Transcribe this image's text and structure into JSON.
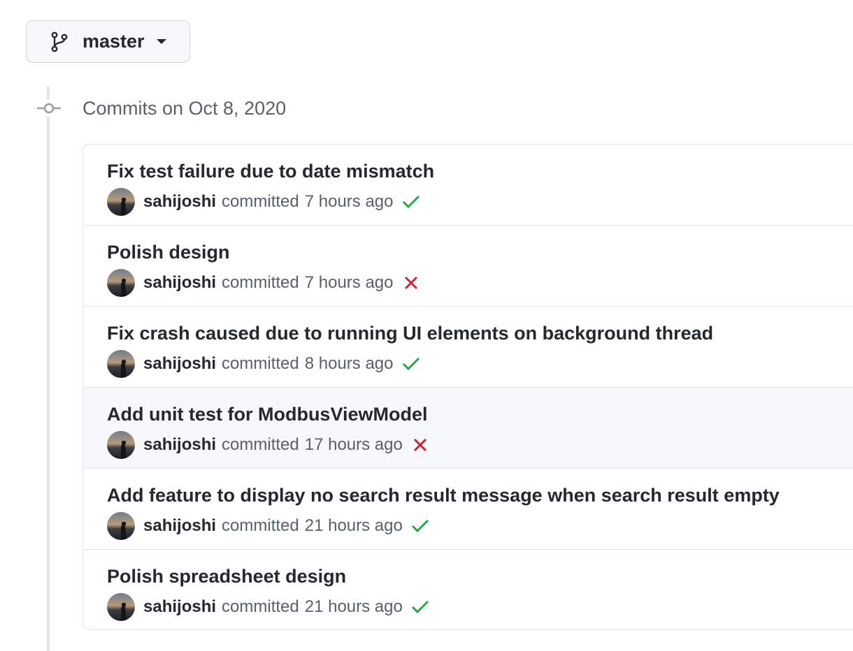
{
  "branch": {
    "name": "master",
    "icon": "git-branch-icon"
  },
  "timeline": {
    "date_heading": "Commits on Oct 8, 2020"
  },
  "colors": {
    "success": "#28a745",
    "failure": "#cb2431"
  },
  "commits": [
    {
      "title": "Fix test failure due to date mismatch",
      "author": "sahijoshi",
      "action": "committed",
      "time": "7 hours ago",
      "status": "success"
    },
    {
      "title": "Polish design",
      "author": "sahijoshi",
      "action": "committed",
      "time": "7 hours ago",
      "status": "failure"
    },
    {
      "title": "Fix crash caused due to running UI elements on background thread",
      "author": "sahijoshi",
      "action": "committed",
      "time": "8 hours ago",
      "status": "success"
    },
    {
      "title": "Add unit test for ModbusViewModel",
      "author": "sahijoshi",
      "action": "committed",
      "time": "17 hours ago",
      "status": "failure"
    },
    {
      "title": "Add feature to display no search result message when search result empty",
      "author": "sahijoshi",
      "action": "committed",
      "time": "21 hours ago",
      "status": "success"
    },
    {
      "title": "Polish spreadsheet design",
      "author": "sahijoshi",
      "action": "committed",
      "time": "21 hours ago",
      "status": "success"
    }
  ]
}
